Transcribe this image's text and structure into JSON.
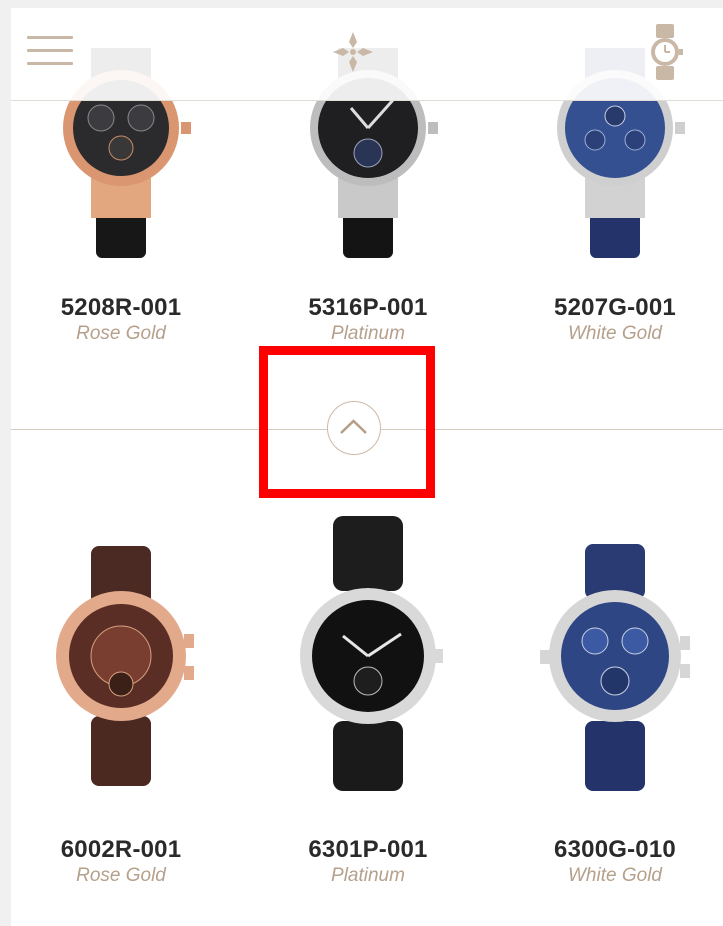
{
  "header": {
    "menu_icon": "hamburger-menu-icon",
    "logo_icon": "calatrava-cross-logo",
    "watch_icon": "watch-icon"
  },
  "products_row1": [
    {
      "ref": "5208R-001",
      "material": "Rose Gold"
    },
    {
      "ref": "5316P-001",
      "material": "Platinum"
    },
    {
      "ref": "5207G-001",
      "material": "White Gold"
    }
  ],
  "products_row2": [
    {
      "ref": "6002R-001",
      "material": "Rose Gold"
    },
    {
      "ref": "6301P-001",
      "material": "Platinum"
    },
    {
      "ref": "6300G-010",
      "material": "White Gold"
    }
  ],
  "scroll_up": {
    "icon": "chevron-up-icon"
  },
  "highlight": {
    "color": "#ff0000"
  },
  "colors": {
    "accent": "#b5a08c",
    "text": "#2a2a2a",
    "divider": "#d6cabe"
  }
}
